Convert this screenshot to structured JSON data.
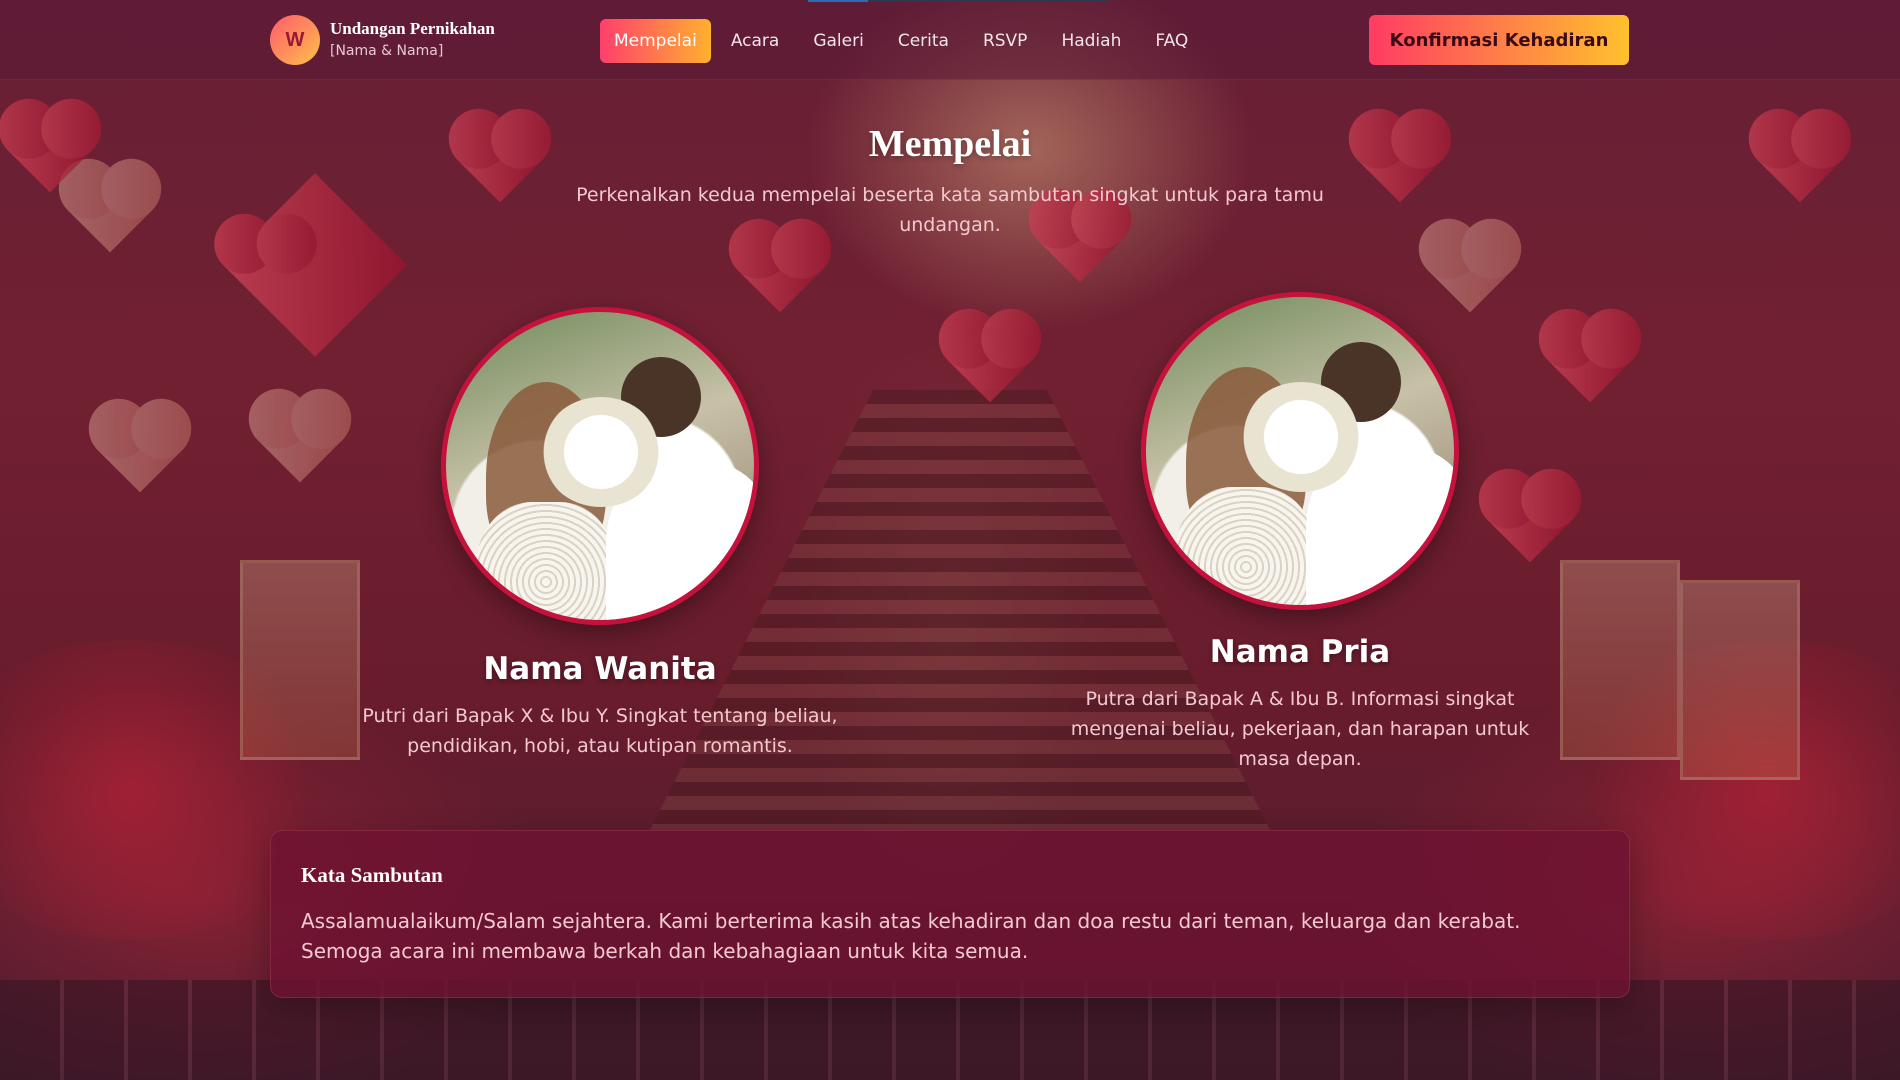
{
  "brand": {
    "logo_letter": "W",
    "title": "Undangan Pernikahan",
    "subtitle": "[Nama & Nama]"
  },
  "nav": {
    "items": [
      {
        "label": "Mempelai",
        "active": true
      },
      {
        "label": "Acara",
        "active": false
      },
      {
        "label": "Galeri",
        "active": false
      },
      {
        "label": "Cerita",
        "active": false
      },
      {
        "label": "RSVP",
        "active": false
      },
      {
        "label": "Hadiah",
        "active": false
      },
      {
        "label": "FAQ",
        "active": false
      }
    ]
  },
  "header": {
    "cta_label": "Konfirmasi Kehadiran"
  },
  "section": {
    "title": "Mempelai",
    "subtitle": "Perkenalkan kedua mempelai beserta kata sambutan singkat untuk para tamu undangan."
  },
  "bride": {
    "name": "Nama Wanita",
    "description": "Putri dari Bapak X & Ibu Y. Singkat tentang beliau, pendidikan, hobi, atau kutipan romantis."
  },
  "groom": {
    "name": "Nama Pria",
    "description": "Putra dari Bapak A & Ibu B. Informasi singkat mengenai beliau, pekerjaan, dan harapan untuk masa depan."
  },
  "greeting": {
    "title": "Kata Sambutan",
    "body": "Assalamualaikum/Salam sejahtera. Kami berterima kasih atas kehadiran dan doa restu dari teman, keluarga dan kerabat. Semoga acara ini membawa berkah dan kebahagiaan untuk kita semua."
  },
  "colors": {
    "accent_start": "#ff3f6c",
    "accent_end": "#ffb02e",
    "photo_border": "#c5123d"
  }
}
